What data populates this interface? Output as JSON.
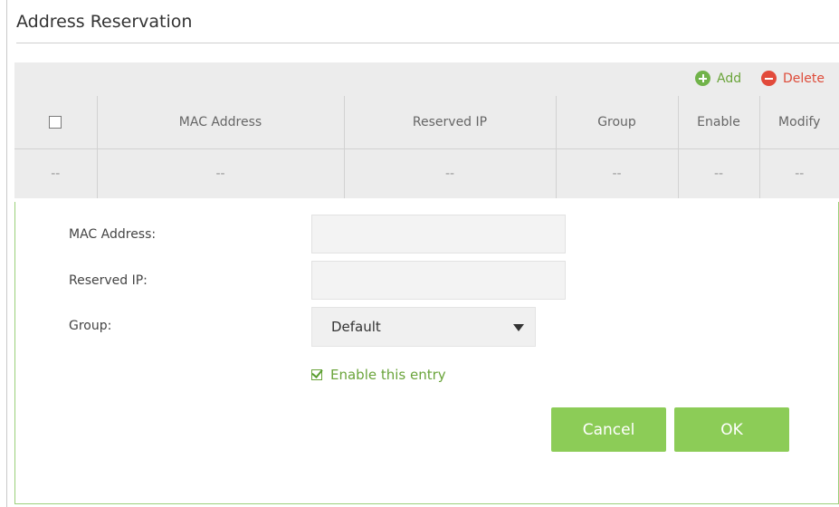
{
  "page": {
    "title": "Address Reservation"
  },
  "toolbar": {
    "add_label": "Add",
    "delete_label": "Delete"
  },
  "table": {
    "headers": [
      "MAC Address",
      "Reserved IP",
      "Group",
      "Enable",
      "Modify"
    ],
    "rows": [
      [
        "--",
        "--",
        "--",
        "--",
        "--",
        "--"
      ]
    ]
  },
  "form": {
    "mac_label": "MAC Address:",
    "mac_value": "",
    "ip_label": "Reserved IP:",
    "ip_value": "",
    "group_label": "Group:",
    "group_selected": "Default",
    "enable_label": "Enable this entry",
    "enable_checked": true,
    "cancel_label": "Cancel",
    "ok_label": "OK"
  },
  "colors": {
    "accent": "#8ccc57",
    "add": "#71b34a",
    "delete": "#e24a3b",
    "table_bg": "#ececec"
  }
}
